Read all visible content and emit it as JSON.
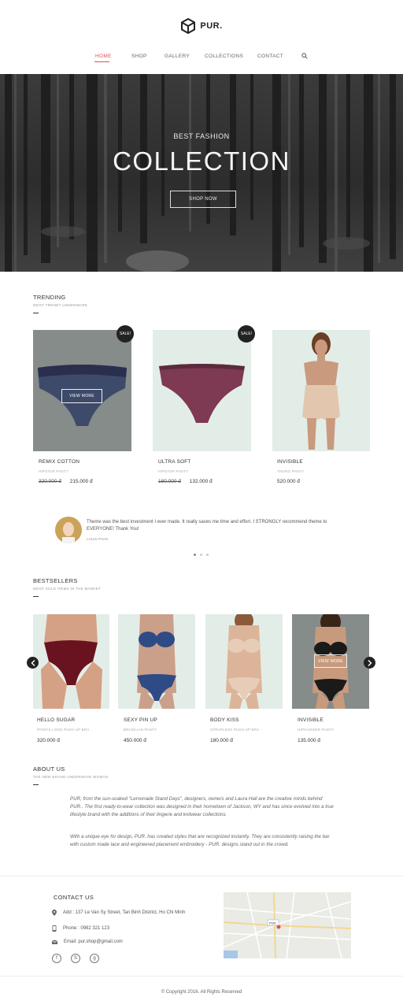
{
  "brand": {
    "name": "PUR."
  },
  "nav": [
    "HOME",
    "SHOP",
    "GALLERY",
    "COLLECTIONS",
    "CONTACT"
  ],
  "hero": {
    "small_title": "BEST FASHION",
    "big_title": "COLLECTION",
    "button": "SHOP NOW"
  },
  "trending": {
    "title": "TRENDING",
    "subtitle": "MOST TRENDY UNDERWARE",
    "sale_label": "SALE!",
    "view_more": "VIEW MORE",
    "products": [
      {
        "name": "REMIX COTTON",
        "type": "HIPSTER PANTY",
        "old_price": "320.000 đ",
        "price": "215.000 đ"
      },
      {
        "name": "ULTRA SOFT",
        "type": "HIPSTER PANTY",
        "old_price": "180.000 đ",
        "price": "132.000 đ"
      },
      {
        "name": "INVISIBLE",
        "type": "THONG PANTY",
        "price": "520.000 đ"
      }
    ]
  },
  "testimonial": {
    "text": "Theme was the best investment I ever made. It really saves me time and effort. I STRONGLY recommend theme to EVERYONE! Thank You!",
    "author": "LOUIS PHAN"
  },
  "bestsellers": {
    "title": "BESTSELLERS",
    "subtitle": "MOST SOLD ITEMS IN THE MARKET",
    "view_more": "VIEW MORE",
    "products": [
      {
        "name": "HELLO SUGAR",
        "type": "PRINTS LOGE PUSH UP BRA",
        "price": "320.000 đ"
      },
      {
        "name": "SEXY PIN UP",
        "type": "BRAZILIAN PANTY",
        "price": "450.000 đ"
      },
      {
        "name": "BODY KISS",
        "type": "STRAPLESS PUSH UP BRA",
        "price": "180.000 đ"
      },
      {
        "name": "INVISIBLE",
        "type": "HIPHUGGER PANTY",
        "price": "135.000 đ"
      }
    ]
  },
  "about": {
    "title": "ABOUT US",
    "subtitle": "THE NEW BRAND UNDERWAVE WOMAN",
    "p1": "PUR, from the sun-soaked \"Lemonade Stand Days\", designers, owners and Laura Hall are the creative minds behind PUR.. The first ready-to-wear collection was designed in their hometown of Jackson, WY and has since evolved into a true lifestyle brand with the additions of their lingerie and knitwear collections.",
    "p2": "With a unique eye for design, PUR. has created styles that are recognized instantly. They are consistently raising the bar with custom made lace and engineered placement embroidery - PUR. designs stand out in the crowd."
  },
  "contact": {
    "title": "CONTACT US",
    "address": "Add : 137 Le Van Sy Street, Tan Binh District, Ho Chi Minh",
    "phone": "Phone : 0982 321 123",
    "email": "Email: pur.shop@gmail.com",
    "map_label": "PUR."
  },
  "footer": {
    "copyright": "© Copyright 2016. All Rights Reserved"
  },
  "colors": {
    "accent": "#d9534f",
    "dark": "#222222",
    "mint_bg": "#e3ede7",
    "grey_bg": "#858c89"
  }
}
